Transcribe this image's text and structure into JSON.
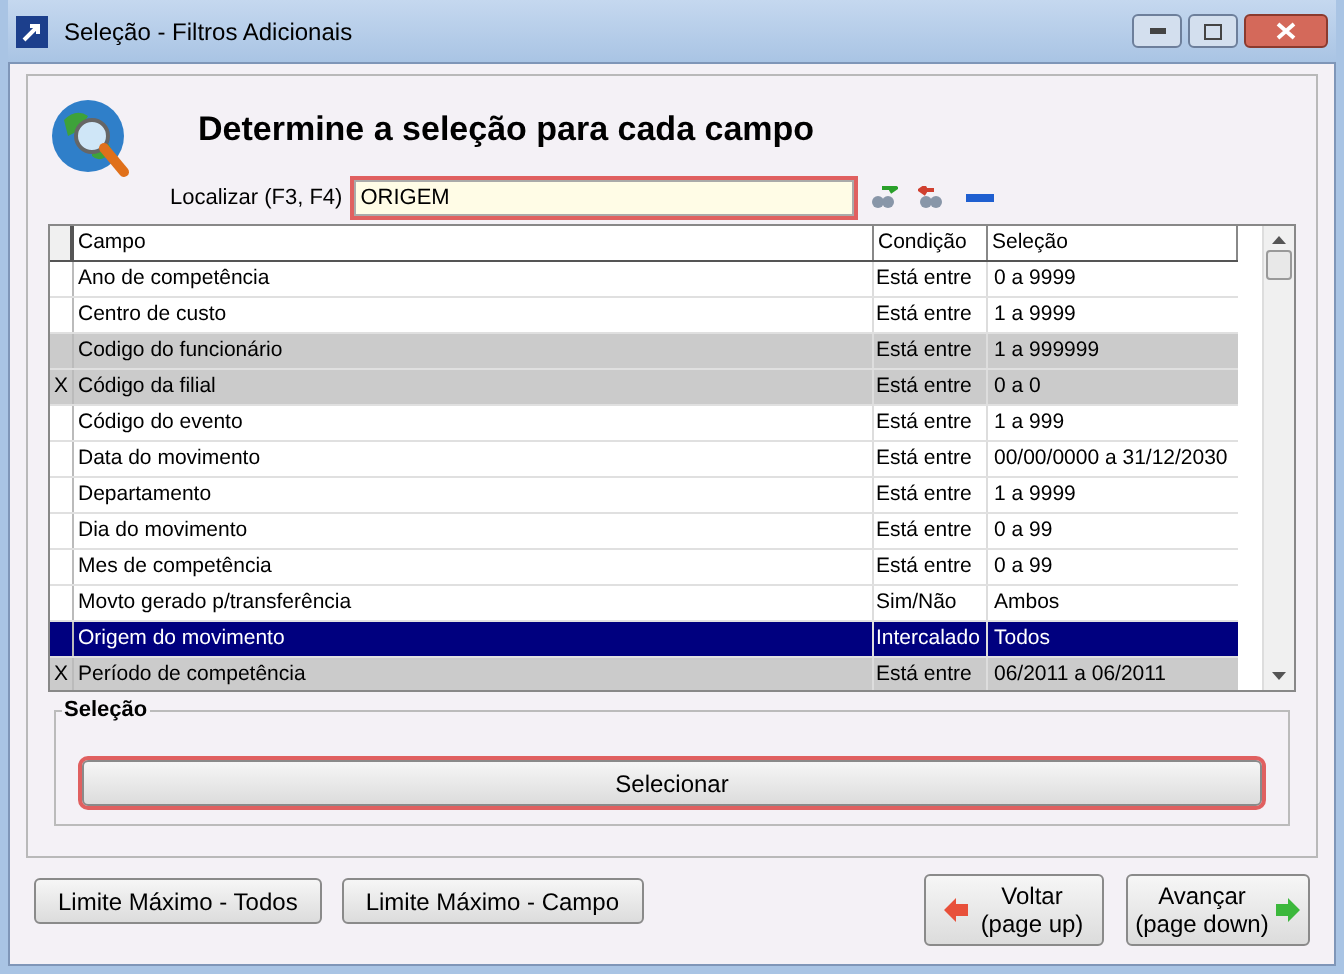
{
  "window": {
    "title": "Seleção - Filtros Adicionais"
  },
  "heading": "Determine a seleção para cada campo",
  "search": {
    "label": "Localizar (F3, F4)",
    "value": "ORIGEM"
  },
  "table": {
    "columns": [
      "Campo",
      "Condição",
      "Seleção"
    ],
    "rows": [
      {
        "marker": "",
        "campo": "Ano de competência",
        "condicao": "Está entre",
        "selecao": "0 a 9999",
        "greyed": false,
        "selected": false
      },
      {
        "marker": "",
        "campo": "Centro de custo",
        "condicao": "Está entre",
        "selecao": "1 a 9999",
        "greyed": false,
        "selected": false
      },
      {
        "marker": "",
        "campo": "Codigo do funcionário",
        "condicao": "Está entre",
        "selecao": "1 a 999999",
        "greyed": true,
        "selected": false
      },
      {
        "marker": "X",
        "campo": "Código da filial",
        "condicao": "Está entre",
        "selecao": "0 a 0",
        "greyed": true,
        "selected": false
      },
      {
        "marker": "",
        "campo": "Código do evento",
        "condicao": "Está entre",
        "selecao": "1 a 999",
        "greyed": false,
        "selected": false
      },
      {
        "marker": "",
        "campo": "Data do movimento",
        "condicao": "Está entre",
        "selecao": "00/00/0000 a 31/12/2030",
        "greyed": false,
        "selected": false
      },
      {
        "marker": "",
        "campo": "Departamento",
        "condicao": "Está entre",
        "selecao": "1 a 9999",
        "greyed": false,
        "selected": false
      },
      {
        "marker": "",
        "campo": "Dia do movimento",
        "condicao": "Está entre",
        "selecao": "0 a 99",
        "greyed": false,
        "selected": false
      },
      {
        "marker": "",
        "campo": "Mes de competência",
        "condicao": "Está entre",
        "selecao": "0 a 99",
        "greyed": false,
        "selected": false
      },
      {
        "marker": "",
        "campo": "Movto gerado p/transferência",
        "condicao": "Sim/Não",
        "selecao": "Ambos",
        "greyed": false,
        "selected": false
      },
      {
        "marker": "",
        "campo": "Origem do movimento",
        "condicao": "Intercalado",
        "selecao": "Todos",
        "greyed": false,
        "selected": true
      },
      {
        "marker": "X",
        "campo": "Período de competência",
        "condicao": "Está entre",
        "selecao": "06/2011 a 06/2011",
        "greyed": true,
        "selected": false
      }
    ]
  },
  "selection_group": {
    "title": "Seleção",
    "button": "Selecionar"
  },
  "footer": {
    "left_buttons": [
      "Limite Máximo - Todos",
      "Limite Máximo - Campo"
    ],
    "back": {
      "label": "Voltar",
      "hint": "(page up)"
    },
    "next": {
      "label": "Avançar",
      "hint": "(page down)"
    }
  }
}
